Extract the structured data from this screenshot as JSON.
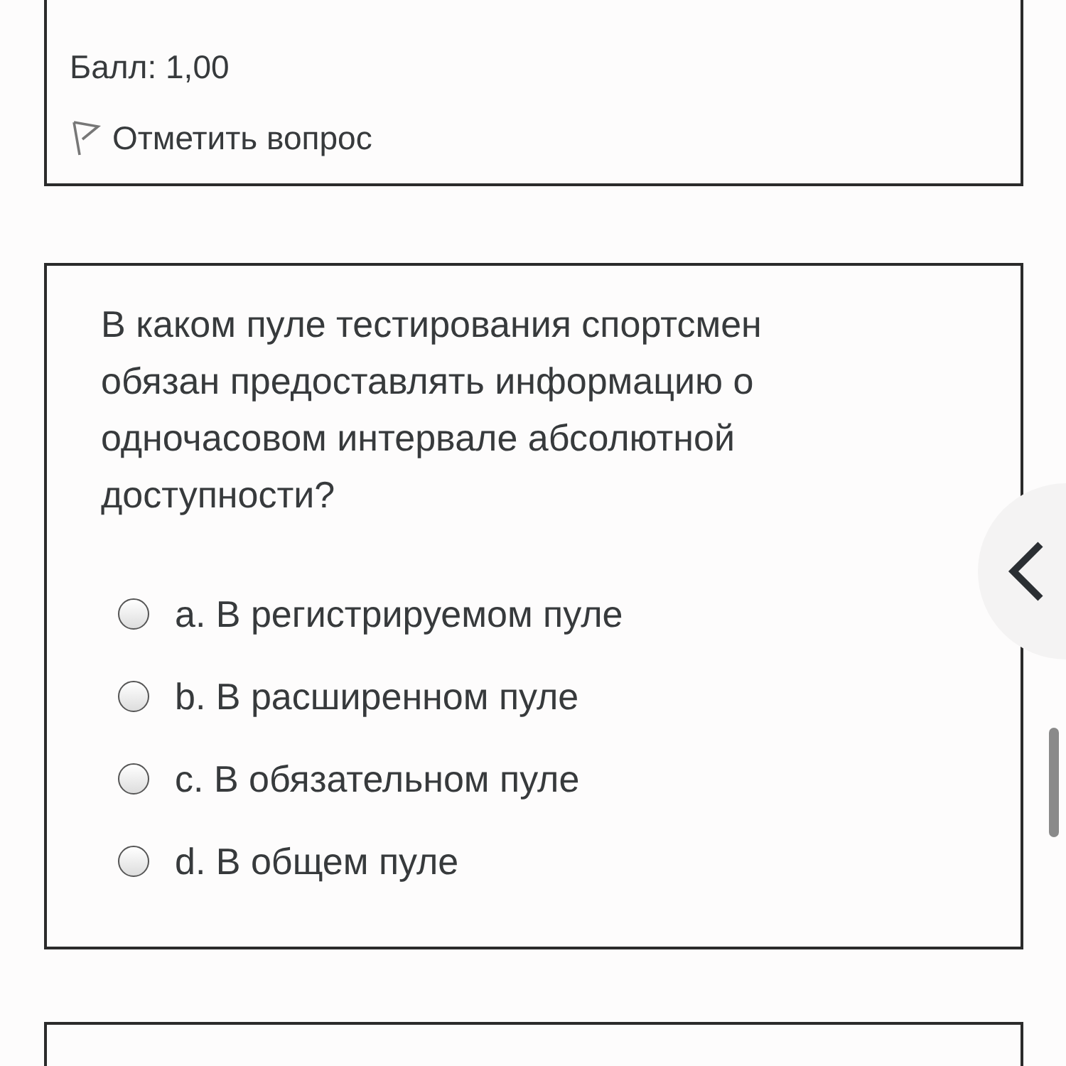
{
  "previous_question": {
    "score": "Балл: 1,00",
    "flag_label": "Отметить вопрос"
  },
  "question": {
    "text": "В каком пуле тестирования спортсмен обязан предоставлять информацию о одночасовом интервале абсолютной доступности?",
    "options": [
      {
        "label": "a. В регистрируемом пуле",
        "selected": false
      },
      {
        "label": "b. В расширенном пуле",
        "selected": false
      },
      {
        "label": "c. В обязательном пуле",
        "selected": false
      },
      {
        "label": "d. В общем пуле",
        "selected": false
      }
    ]
  }
}
